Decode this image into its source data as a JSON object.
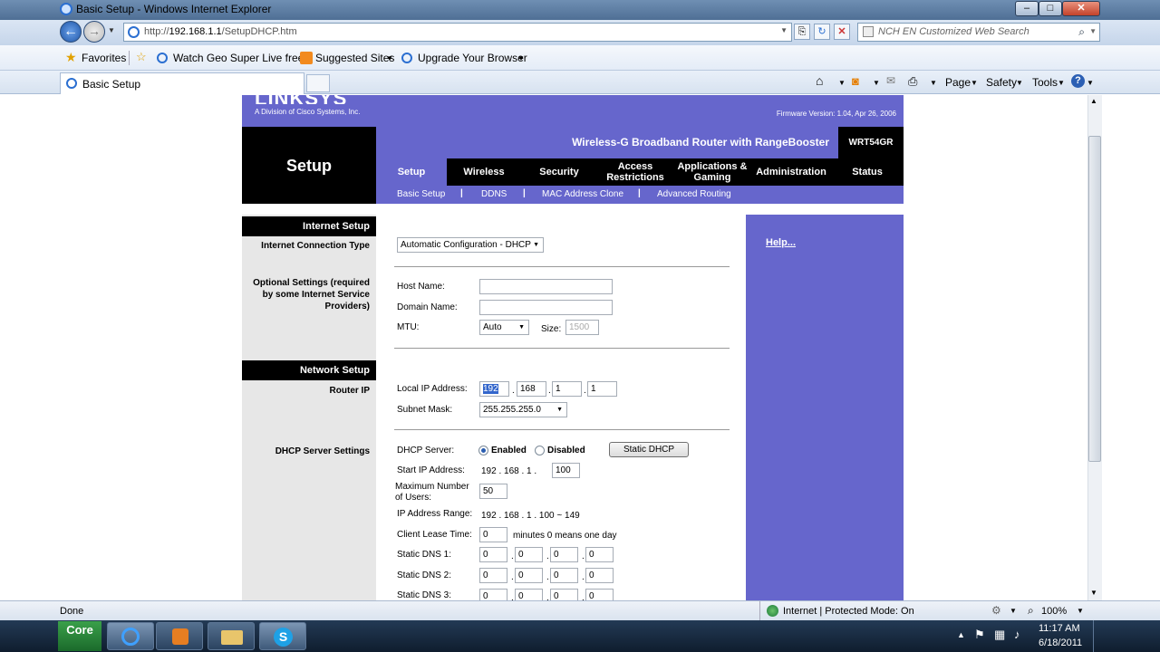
{
  "browser": {
    "window_title": "Basic Setup - Windows Internet Explorer",
    "url_prefix": "http://",
    "url_host": "192.168.1.1",
    "url_path": "/SetupDHCP.htm",
    "search_placeholder": "NCH EN Customized Web Search",
    "favorites_label": "Favorites",
    "fav_items": [
      "Watch Geo Super Live free...",
      "Suggested Sites",
      "Upgrade Your Browser"
    ],
    "tab_title": "Basic Setup",
    "commands": [
      "Page",
      "Safety",
      "Tools"
    ],
    "status_left": "Done",
    "status_zone": "Internet | Protected Mode: On",
    "zoom": "100%"
  },
  "taskbar": {
    "time": "11:17 AM",
    "date": "6/18/2011"
  },
  "router": {
    "vendor_sub": "A Division of Cisco Systems, Inc.",
    "firmware": "Firmware Version: 1.04, Apr 26, 2006",
    "section_title": "Setup",
    "product_name": "Wireless-G Broadband Router with RangeBooster",
    "model": "WRT54GR",
    "tabs": [
      "Setup",
      "Wireless",
      "Security",
      "Access Restrictions",
      "Applications & Gaming",
      "Administration",
      "Status"
    ],
    "subtabs": [
      "Basic Setup",
      "DDNS",
      "MAC Address Clone",
      "Advanced Routing"
    ],
    "help_link": "Help...",
    "internet_setup": {
      "header": "Internet Setup",
      "conn_type_label": "Internet Connection Type",
      "conn_type_value": "Automatic Configuration - DHCP",
      "optional_label": "Optional Settings (required by some Internet Service Providers)",
      "host_name_label": "Host Name:",
      "host_name_value": "",
      "domain_name_label": "Domain Name:",
      "domain_name_value": "",
      "mtu_label": "MTU:",
      "mtu_value": "Auto",
      "size_label": "Size:",
      "size_value": "1500"
    },
    "network_setup": {
      "header": "Network Setup",
      "router_ip_label": "Router IP",
      "local_ip_label": "Local IP Address:",
      "local_ip": [
        "192",
        "168",
        "1",
        "1"
      ],
      "subnet_label": "Subnet Mask:",
      "subnet_value": "255.255.255.0",
      "dhcp_settings_label": "DHCP Server Settings",
      "dhcp_server_label": "DHCP Server:",
      "enabled_label": "Enabled",
      "disabled_label": "Disabled",
      "static_dhcp_button": "Static DHCP",
      "start_ip_label": "Start IP Address:",
      "start_ip_prefix": "192 . 168 . 1 .",
      "start_ip_last": "100",
      "max_users_label": "Maximum Number of Users:",
      "max_users_value": "50",
      "ip_range_label": "IP Address Range:",
      "ip_range_value": "192 . 168 . 1 . 100 ~ 149",
      "lease_label": "Client Lease Time:",
      "lease_value": "0",
      "lease_suffix": "minutes 0 means one day",
      "dns1_label": "Static DNS 1:",
      "dns1": [
        "0",
        "0",
        "0",
        "0"
      ],
      "dns2_label": "Static DNS 2:",
      "dns2": [
        "0",
        "0",
        "0",
        "0"
      ],
      "dns3_label": "Static DNS 3:",
      "dns3": [
        "0",
        "0",
        "0",
        "0"
      ]
    }
  }
}
